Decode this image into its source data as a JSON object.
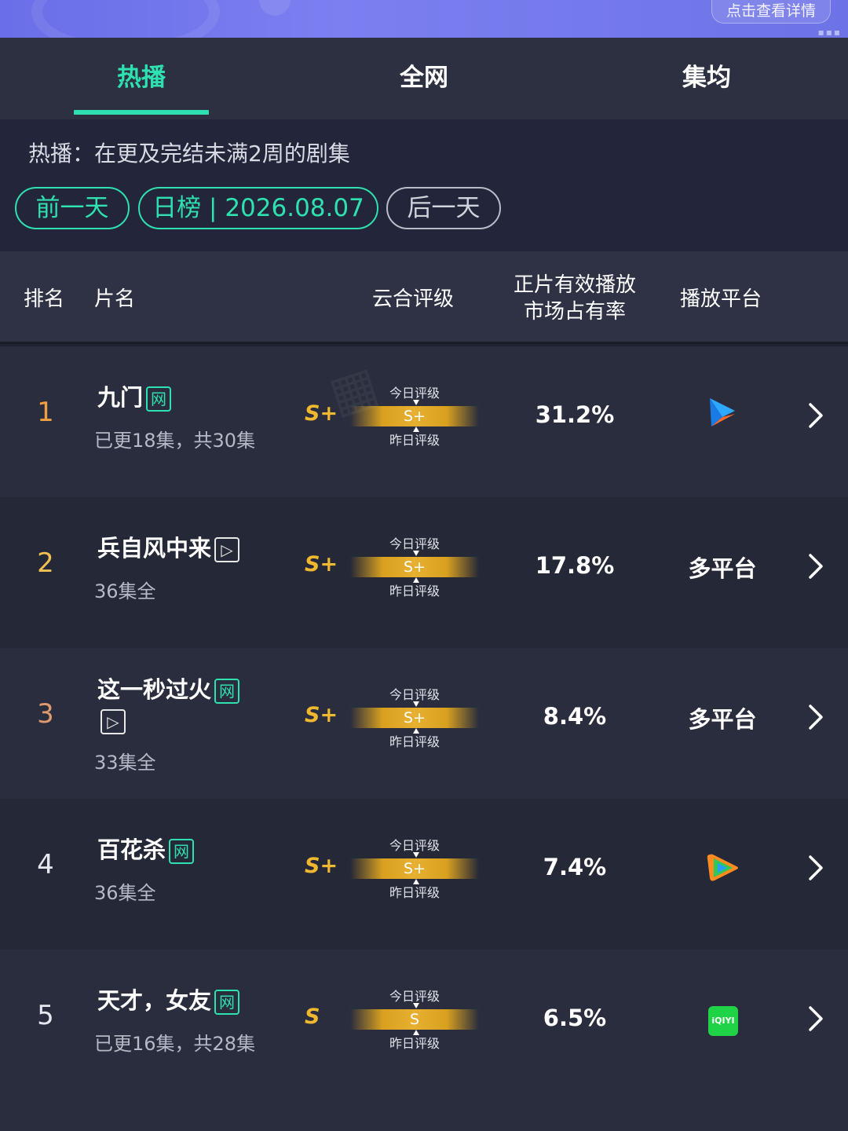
{
  "banner": {
    "detail_label": "点击查看详情"
  },
  "tabs": [
    {
      "label": "热播",
      "active": true
    },
    {
      "label": "全网",
      "active": false
    },
    {
      "label": "集均",
      "active": false
    }
  ],
  "info": {
    "description": "热播：在更及完结未满2周的剧集",
    "prev_label": "前一天",
    "date_label": "日榜 | 2026.08.07",
    "next_label": "后一天"
  },
  "table": {
    "headers": {
      "rank": "排名",
      "title": "片名",
      "grade": "云合评级",
      "share_line1": "正片有效播放",
      "share_line2": "市场占有率",
      "platform": "播放平台"
    },
    "grade_today_label": "今日评级",
    "grade_yesterday_label": "昨日评级",
    "rows": [
      {
        "rank": "1",
        "title": "九门",
        "badges": [
          "网"
        ],
        "sub": "已更18集，共30集",
        "grade": "S+",
        "bar_grade": "S+",
        "share": "31.2%",
        "platform": "",
        "platform_icon": "youku-icon"
      },
      {
        "rank": "2",
        "title": "兵自风中来",
        "badges": [
          "▷"
        ],
        "sub": "36集全",
        "grade": "S+",
        "bar_grade": "S+",
        "share": "17.8%",
        "platform": "多平台",
        "platform_icon": ""
      },
      {
        "rank": "3",
        "title": "这一秒过火",
        "badges": [
          "网",
          "▷"
        ],
        "sub": "33集全",
        "grade": "S+",
        "bar_grade": "S+",
        "share": "8.4%",
        "platform": "多平台",
        "platform_icon": ""
      },
      {
        "rank": "4",
        "title": "百花杀",
        "badges": [
          "网"
        ],
        "sub": "36集全",
        "grade": "S+",
        "bar_grade": "S+",
        "share": "7.4%",
        "platform": "",
        "platform_icon": "tencent-video-icon"
      },
      {
        "rank": "5",
        "title": "天才，女友",
        "badges": [
          "网"
        ],
        "sub": "已更16集，共28集",
        "grade": "S",
        "bar_grade": "S",
        "share": "6.5%",
        "platform": "",
        "platform_icon": "iqiyi-icon"
      }
    ]
  },
  "colors": {
    "accent": "#2fe0b0",
    "grade_gold": "#f0b830",
    "rank1": "#f0a040",
    "rank2": "#f0c050",
    "rank3": "#e09a70"
  }
}
